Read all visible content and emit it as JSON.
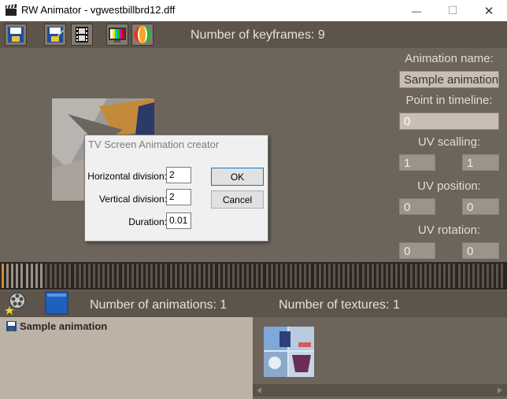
{
  "window": {
    "title": "RW Animator - vgwestbillbrd12.dff",
    "minimize_glyph": "—",
    "maximize_glyph": "☐",
    "close_glyph": "✕"
  },
  "top_toolbar": {
    "buttons": [
      "save-icon",
      "save-as-icon",
      "film-strip-icon",
      "tv-screen-icon",
      "beach-ball-icon"
    ],
    "keyframes_text": "Number of keyframes: 9"
  },
  "properties": {
    "animation_name_label": "Animation name:",
    "animation_name_value": "Sample animation",
    "timeline_point_label": "Point in timeline:",
    "timeline_point_value": "0",
    "uv_scaling_label": "UV scalling:",
    "uv_scaling_u": "1",
    "uv_scaling_v": "1",
    "uv_position_label": "UV position:",
    "uv_position_u": "0",
    "uv_position_v": "0",
    "uv_rotation_label": "UV rotation:",
    "uv_rotation_u": "0",
    "uv_rotation_v": "0"
  },
  "timeline": {
    "keyframe_count": 9,
    "selected_index": 0,
    "accent_color": "#d08a3c"
  },
  "bottom_toolbar": {
    "animations_text": "Number of animations: 1",
    "textures_text": "Number of textures: 1"
  },
  "animation_list": {
    "items": [
      "Sample animation"
    ]
  },
  "dialog": {
    "title": "TV Screen Animation creator",
    "horizontal_label": "Horizontal division:",
    "horizontal_value": "2",
    "vertical_label": "Vertical division:",
    "vertical_value": "2",
    "duration_label": "Duration:",
    "duration_value": "0.01",
    "ok_label": "OK",
    "cancel_label": "Cancel"
  },
  "colors": {
    "surface": "#6d645b",
    "toolbar": "#5d544b",
    "field_fill": "#c8beb4",
    "list_fill": "#bdb2a6"
  }
}
